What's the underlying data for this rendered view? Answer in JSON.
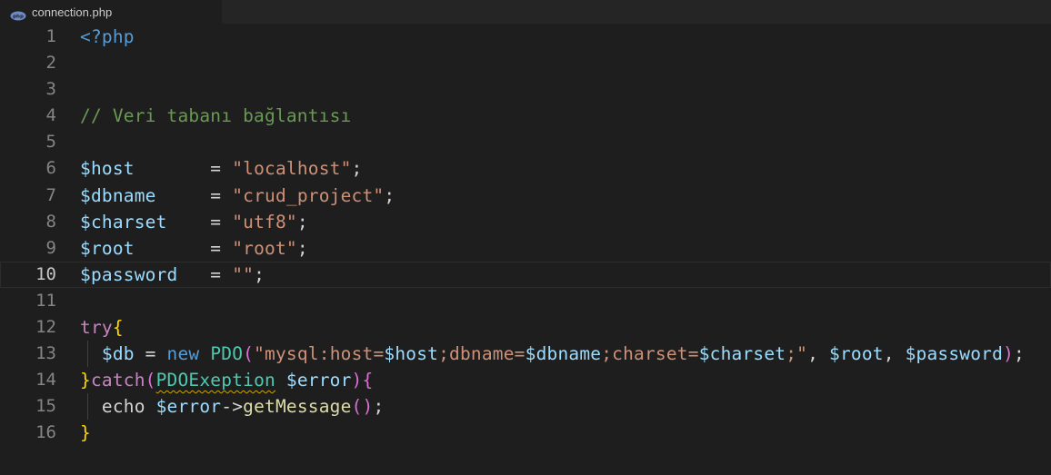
{
  "tab": {
    "filename": "connection.php",
    "icon": "php-file-icon"
  },
  "colors": {
    "background": "#1e1e1e",
    "keyword_tag": "#569cd6",
    "comment": "#6a9955",
    "variable": "#9cdcfe",
    "string": "#ce9178",
    "control": "#c586c0",
    "brace": "#ffd700",
    "class": "#4ec9b0",
    "function": "#dcdcaa"
  },
  "editor": {
    "active_line": 10,
    "lines": [
      {
        "num": "1",
        "text": "<?php"
      },
      {
        "num": "2",
        "text": ""
      },
      {
        "num": "3",
        "text": ""
      },
      {
        "num": "4",
        "text": "// Veri tabanı bağlantısı"
      },
      {
        "num": "5",
        "text": ""
      },
      {
        "num": "6",
        "text": "$host       = \"localhost\";"
      },
      {
        "num": "7",
        "text": "$dbname     = \"crud_project\";"
      },
      {
        "num": "8",
        "text": "$charset    = \"utf8\";"
      },
      {
        "num": "9",
        "text": "$root       = \"root\";"
      },
      {
        "num": "10",
        "text": "$password   = \"\";"
      },
      {
        "num": "11",
        "text": ""
      },
      {
        "num": "12",
        "text": "try{"
      },
      {
        "num": "13",
        "text": "  $db = new PDO(\"mysql:host=$host;dbname=$dbname;charset=$charset;\", $root, $password);"
      },
      {
        "num": "14",
        "text": "}catch(PDOExeption $error){"
      },
      {
        "num": "15",
        "text": "  echo $error->getMessage();"
      },
      {
        "num": "16",
        "text": "}"
      }
    ]
  },
  "tokens": {
    "l1": {
      "tag": "<?php"
    },
    "l4": {
      "comment": "// Veri tabanı bağlantısı"
    },
    "l6": {
      "var": "$host",
      "pad": "       ",
      "eq": "= ",
      "str": "\"localhost\"",
      "semi": ";"
    },
    "l7": {
      "var": "$dbname",
      "pad": "     ",
      "eq": "= ",
      "str": "\"crud_project\"",
      "semi": ";"
    },
    "l8": {
      "var": "$charset",
      "pad": "    ",
      "eq": "= ",
      "str": "\"utf8\"",
      "semi": ";"
    },
    "l9": {
      "var": "$root",
      "pad": "       ",
      "eq": "= ",
      "str": "\"root\"",
      "semi": ";"
    },
    "l10": {
      "var": "$password",
      "pad": "   ",
      "eq": "= ",
      "str": "\"\"",
      "semi": ";"
    },
    "l12": {
      "kw": "try",
      "brace": "{"
    },
    "l13": {
      "indent": "  ",
      "var_db": "$db",
      "eq": " = ",
      "new": "new",
      "sp": " ",
      "cls": "PDO",
      "paren_open": "(",
      "s1": "\"mysql:host=",
      "v1": "$host",
      "s2": ";dbname=",
      "v2": "$dbname",
      "s3": ";charset=",
      "v3": "$charset",
      "s4": ";\"",
      "comma1": ", ",
      "v4": "$root",
      "comma2": ", ",
      "v5": "$password",
      "paren_close": ")",
      "semi": ";"
    },
    "l14": {
      "brace_close": "}",
      "kw": "catch",
      "paren_open": "(",
      "cls": "PDOExeption",
      "sp": " ",
      "var": "$error",
      "paren_close": ")",
      "brace_open": "{"
    },
    "l15": {
      "indent": "  ",
      "kw": "echo",
      "sp": " ",
      "var": "$error",
      "arrow": "->",
      "func": "getMessage",
      "paren_open": "(",
      "paren_close": ")",
      "semi": ";"
    },
    "l16": {
      "brace": "}"
    }
  }
}
